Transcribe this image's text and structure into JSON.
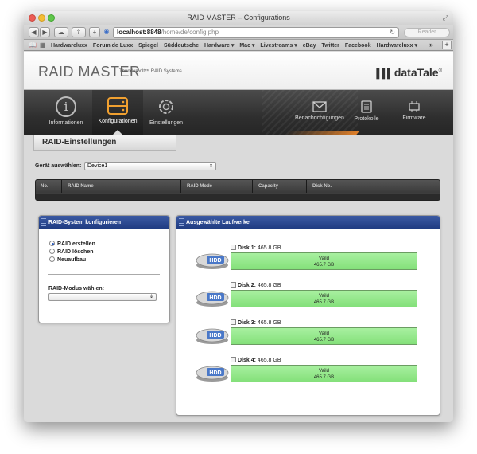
{
  "window": {
    "title": "RAID MASTER – Configurations"
  },
  "toolbar": {
    "url_host": "localhost:8848",
    "url_path": "/home/de/config.php",
    "reader_label": "Reader"
  },
  "bookmarks": [
    "Hardwareluxx",
    "Forum de Luxx",
    "Spiegel",
    "Süddeutsche",
    "Hardware ▾",
    "Mac ▾",
    "Livestreams ▾",
    "eBay",
    "Twitter",
    "Facebook",
    "Hardwareluxx ▾"
  ],
  "header": {
    "brand": "RAID MASTER",
    "subtitle": "Thunderbolt™ RAID Systems",
    "logo": "dataTale",
    "logo_mark": "®"
  },
  "nav": {
    "items": [
      {
        "label": "Informationen",
        "icon": "info-icon"
      },
      {
        "label": "Konfigurationen",
        "icon": "drive-icon",
        "active": true
      },
      {
        "label": "Einstellungen",
        "icon": "gear-icon"
      },
      {
        "label": "Benachrichtigungen",
        "icon": "mail-icon"
      },
      {
        "label": "Protokolle",
        "icon": "log-icon"
      },
      {
        "label": "Firmware",
        "icon": "chip-icon"
      }
    ]
  },
  "section_title": "RAID-Einstellungen",
  "device": {
    "label": "Gerät auswählen:",
    "selected": "Device1"
  },
  "raid_table": {
    "columns": [
      "No.",
      "RAID Name",
      "RAID Mode",
      "Capacity",
      "Disk No."
    ]
  },
  "config_panel": {
    "title": "RAID-System konfigurieren",
    "options": [
      {
        "label": "RAID erstellen",
        "checked": true
      },
      {
        "label": "RAID löschen",
        "checked": false
      },
      {
        "label": "Neuaufbau",
        "checked": false
      }
    ],
    "mode_label": "RAID-Modus wählen:",
    "mode_selected": ""
  },
  "drives_panel": {
    "title": "Ausgewählte Laufwerke",
    "hdd_badge": "HDD",
    "disks": [
      {
        "name": "Disk 1:",
        "size": "465.8 GB",
        "status": "Vaild",
        "capacity": "465.7 GB"
      },
      {
        "name": "Disk 2:",
        "size": "465.8 GB",
        "status": "Vaild",
        "capacity": "465.7 GB"
      },
      {
        "name": "Disk 3:",
        "size": "465.8 GB",
        "status": "Vaild",
        "capacity": "465.7 GB"
      },
      {
        "name": "Disk 4:",
        "size": "465.8 GB",
        "status": "Vaild",
        "capacity": "465.7 GB"
      }
    ]
  },
  "colors": {
    "panel_header": "#2a4590",
    "disk_bar": "#9aea8f",
    "nav_accent": "#e0802a"
  }
}
